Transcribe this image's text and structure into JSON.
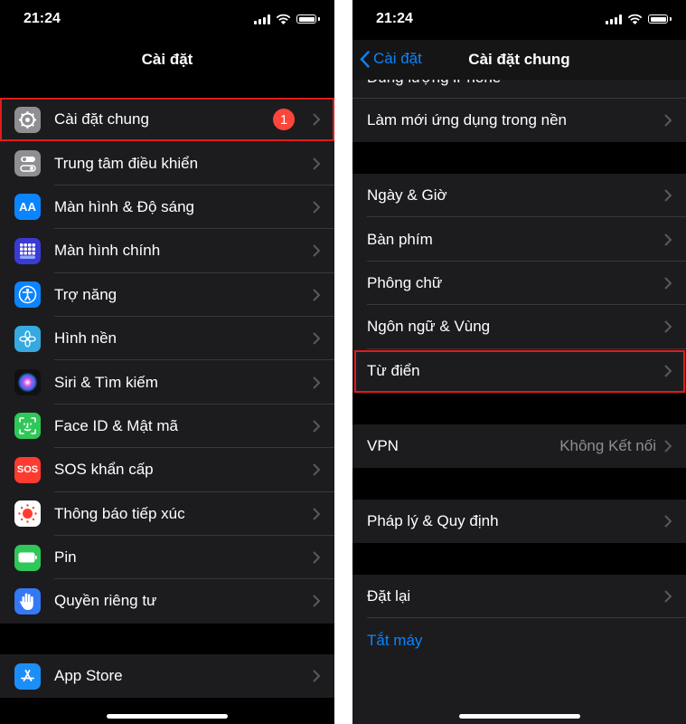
{
  "status": {
    "time": "21:24"
  },
  "left": {
    "title": "Cài đặt",
    "items": [
      {
        "label": "Cài đặt chung",
        "icon": "gear-icon",
        "color": "#8e8e93",
        "badge": "1"
      },
      {
        "label": "Trung tâm điều khiển",
        "icon": "toggles-icon",
        "color": "#8e8e93"
      },
      {
        "label": "Màn hình & Độ sáng",
        "icon": "display-brightness-icon",
        "color": "#0a84ff"
      },
      {
        "label": "Màn hình chính",
        "icon": "home-screen-grid-icon",
        "color": "#3a3ad6"
      },
      {
        "label": "Trợ năng",
        "icon": "accessibility-icon",
        "color": "#0a84ff"
      },
      {
        "label": "Hình nền",
        "icon": "wallpaper-flower-icon",
        "color": "#35a9e0"
      },
      {
        "label": "Siri & Tìm kiếm",
        "icon": "siri-icon",
        "color": "#111111"
      },
      {
        "label": "Face ID & Mật mã",
        "icon": "face-id-icon",
        "color": "#30c759"
      },
      {
        "label": "SOS khẩn cấp",
        "icon": "sos-icon",
        "color": "#ff3b30",
        "icon_text": "SOS"
      },
      {
        "label": "Thông báo tiếp xúc",
        "icon": "exposure-notification-icon",
        "color": "#ffffff"
      },
      {
        "label": "Pin",
        "icon": "battery-icon",
        "color": "#30c759"
      },
      {
        "label": "Quyền riêng tư",
        "icon": "hand-icon",
        "color": "#3478f6"
      }
    ],
    "appstore": {
      "label": "App Store",
      "icon": "app-store-icon",
      "color": "#1c8ef9"
    }
  },
  "right": {
    "back_label": "Cài đặt",
    "title": "Cài đặt chung",
    "clipped_row": "Dung lượng iPhone",
    "group1": [
      "Làm mới ứng dụng trong nền"
    ],
    "group2": [
      "Ngày & Giờ",
      "Bàn phím",
      "Phông chữ",
      "Ngôn ngữ & Vùng",
      "Từ điển"
    ],
    "vpn": {
      "label": "VPN",
      "value": "Không Kết nối"
    },
    "legal": "Pháp lý & Quy định",
    "reset": "Đặt lại",
    "shutdown": "Tắt máy"
  }
}
